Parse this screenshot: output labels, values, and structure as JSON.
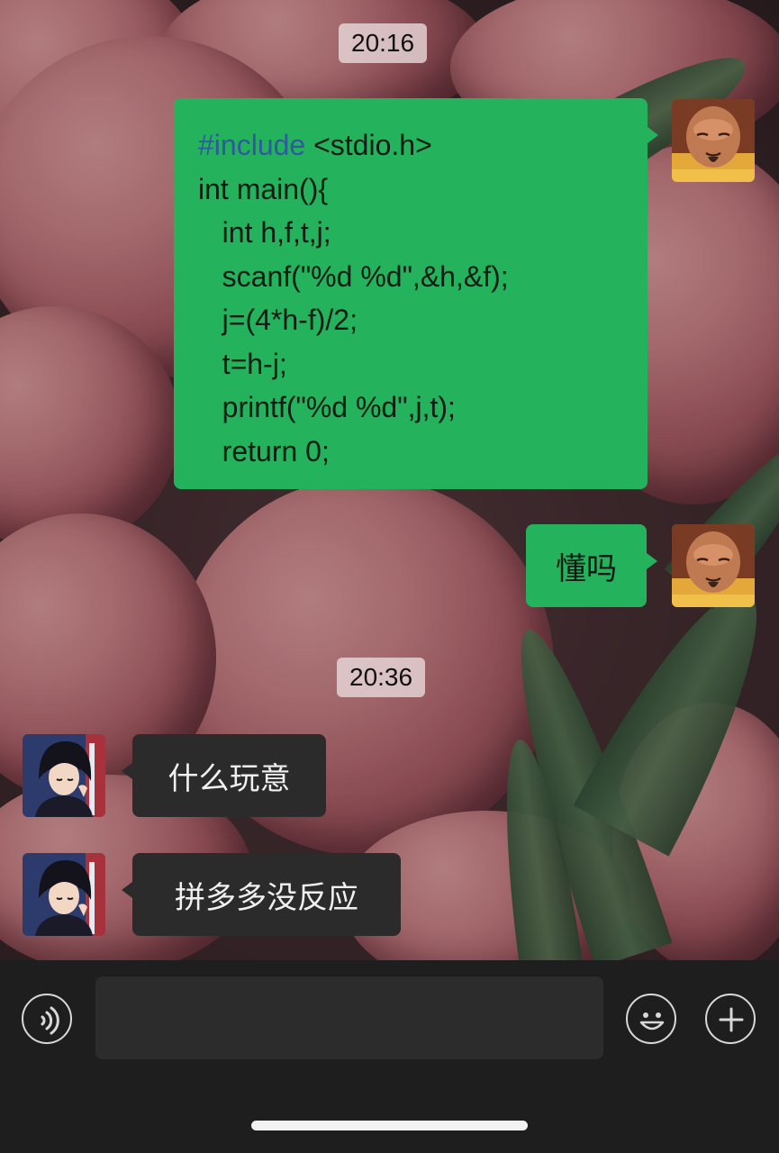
{
  "chat": {
    "timestamps": [
      "20:16",
      "20:36"
    ],
    "messages": [
      {
        "sender": "self",
        "type": "code",
        "lines": [
          {
            "keyword": "#include",
            "rest": " <stdio.h>"
          },
          {
            "keyword": "",
            "rest": "int main(){"
          },
          {
            "keyword": "",
            "rest": "   int h,f,t,j;"
          },
          {
            "keyword": "",
            "rest": "   scanf(\"%d %d\",&h,&f);"
          },
          {
            "keyword": "",
            "rest": "   j=(4*h-f)/2;"
          },
          {
            "keyword": "",
            "rest": "   t=h-j;"
          },
          {
            "keyword": "",
            "rest": "   printf(\"%d %d\",j,t);"
          },
          {
            "keyword": "",
            "rest": "   return 0;"
          }
        ]
      },
      {
        "sender": "self",
        "type": "text",
        "text": "懂吗"
      },
      {
        "sender": "peer",
        "type": "text",
        "text": "什么玩意"
      },
      {
        "sender": "peer",
        "type": "text",
        "text": "拼多多没反应"
      }
    ]
  },
  "input_bar": {
    "voice_icon": "voice-icon",
    "emoji_icon": "emoji-icon",
    "plus_icon": "plus-icon",
    "input_value": ""
  },
  "colors": {
    "outgoing_bubble": "#24b25d",
    "incoming_bubble": "#2b2b2b",
    "code_keyword": "#2f5aa0",
    "input_bar_bg": "#1e1e1e"
  }
}
